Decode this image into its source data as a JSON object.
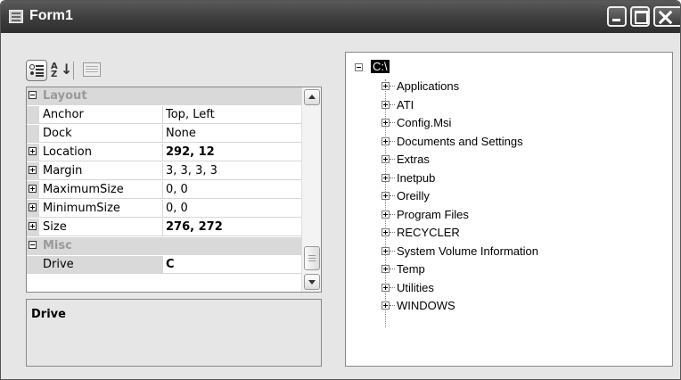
{
  "window": {
    "title": "Form1",
    "icon": "form-window-icon",
    "controls": [
      "minimize-icon",
      "maximize-icon",
      "close-icon"
    ]
  },
  "propertyGrid": {
    "toolbar": [
      "categorized-icon",
      "alphabetical-icon",
      "property-pages-icon"
    ],
    "categories": [
      {
        "name": "Layout",
        "expanded": true,
        "properties": [
          {
            "name": "Anchor",
            "value": "Top, Left",
            "expandable": false,
            "bold": false
          },
          {
            "name": "Dock",
            "value": "None",
            "expandable": false,
            "bold": false
          },
          {
            "name": "Location",
            "value": "292, 12",
            "expandable": true,
            "bold": true
          },
          {
            "name": "Margin",
            "value": "3, 3, 3, 3",
            "expandable": true,
            "bold": false
          },
          {
            "name": "MaximumSize",
            "value": "0, 0",
            "expandable": true,
            "bold": false
          },
          {
            "name": "MinimumSize",
            "value": "0, 0",
            "expandable": true,
            "bold": false
          },
          {
            "name": "Size",
            "value": "276, 272",
            "expandable": true,
            "bold": true
          }
        ]
      },
      {
        "name": "Misc",
        "expanded": true,
        "properties": [
          {
            "name": "Drive",
            "value": "C",
            "expandable": false,
            "bold": true,
            "selected": true
          }
        ]
      }
    ],
    "helpTitle": "Drive",
    "helpDescription": ""
  },
  "treeView": {
    "root": "C:\\",
    "children": [
      "Applications",
      "ATI",
      "Config.Msi",
      "Documents and Settings",
      "Extras",
      "Inetpub",
      "Oreilly",
      "Program Files",
      "RECYCLER",
      "System Volume Information",
      "Temp",
      "Utilities",
      "WINDOWS"
    ]
  }
}
